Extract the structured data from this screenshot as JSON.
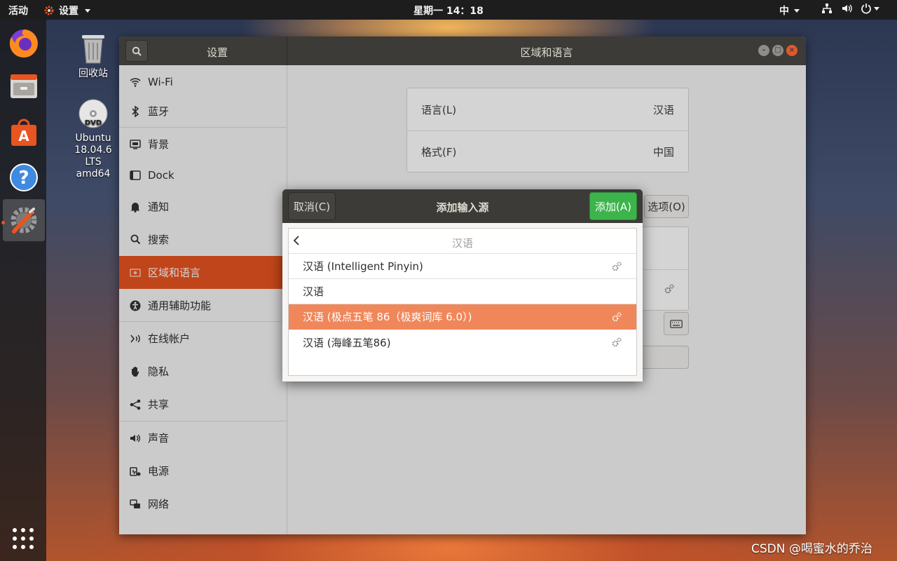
{
  "topbar": {
    "activities": "活动",
    "app_menu": "设置",
    "clock": "星期一 14：18",
    "input_method": "中"
  },
  "desktop": {
    "trash_label": "回收站",
    "dvd_label_1": "Ubuntu",
    "dvd_label_2": "18.04.6 LTS",
    "dvd_label_3": "amd64"
  },
  "settings_window": {
    "sidebar_title": "设置",
    "panel_title": "区域和语言",
    "sidebar": {
      "items": [
        {
          "label": "Wi-Fi",
          "icon": "wifi-icon"
        },
        {
          "label": "蓝牙",
          "icon": "bluetooth-icon"
        },
        {
          "label": "背景",
          "icon": "background-icon"
        },
        {
          "label": "Dock",
          "icon": "dock-icon"
        },
        {
          "label": "通知",
          "icon": "bell-icon"
        },
        {
          "label": "搜索",
          "icon": "search-icon"
        },
        {
          "label": "区域和语言",
          "icon": "flag-icon",
          "active": true
        },
        {
          "label": "通用辅助功能",
          "icon": "accessibility-icon"
        },
        {
          "label": "在线帐户",
          "icon": "online-accounts-icon"
        },
        {
          "label": "隐私",
          "icon": "hand-icon"
        },
        {
          "label": "共享",
          "icon": "share-icon"
        },
        {
          "label": "声音",
          "icon": "speaker-icon"
        },
        {
          "label": "电源",
          "icon": "power-icon"
        },
        {
          "label": "网络",
          "icon": "network-icon"
        }
      ]
    },
    "region": {
      "language_label": "语言(L)",
      "language_value": "汉语",
      "formats_label": "格式(F)",
      "formats_value": "中国",
      "options_button": "选项(O)"
    }
  },
  "dialog": {
    "title": "添加输入源",
    "cancel": "取消(C)",
    "add": "添加(A)",
    "back_label": "汉语",
    "rows": [
      {
        "label": "汉语 (Intelligent Pinyin)",
        "has_settings": true
      },
      {
        "label": "汉语",
        "has_settings": false
      },
      {
        "label": "汉语 (极点五笔 86（极爽词库 6.0）)",
        "has_settings": true,
        "selected": true
      },
      {
        "label": "汉语 (海峰五笔86)",
        "has_settings": true
      }
    ]
  },
  "watermark": "CSDN @喝蜜水的乔治",
  "colors": {
    "accent": "#e95420",
    "selection": "#f0875a",
    "add_button": "#3cb44b",
    "header": "#3c3b37"
  }
}
